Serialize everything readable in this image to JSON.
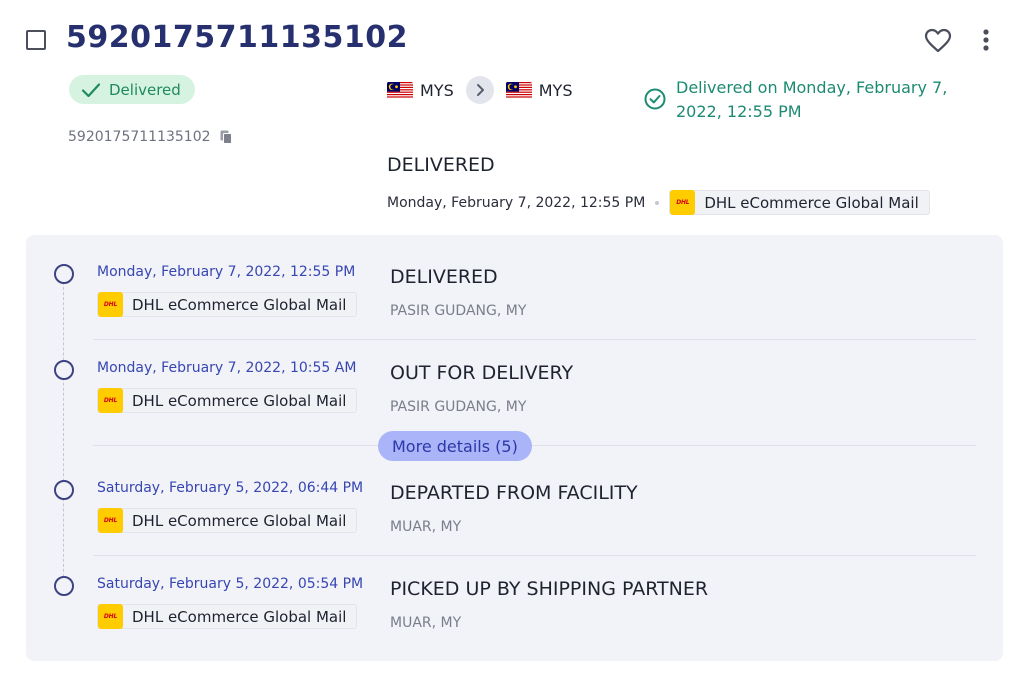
{
  "shipment": {
    "tracking_number": "5920175711135102",
    "sub_number": "5920175711135102",
    "status_badge": "Delivered",
    "origin_country": "MYS",
    "destination_country": "MYS",
    "delivered_on": "Delivered on Monday, February 7, 2022, 12:55 PM",
    "latest_status": "DELIVERED",
    "latest_datetime": "Monday, February 7, 2022, 12:55 PM",
    "latest_carrier": "DHL eCommerce Global Mail"
  },
  "icons": {
    "favorite": "heart-icon",
    "menu": "kebab-icon",
    "copy": "copy-icon",
    "badge_check": "check-icon",
    "delivered_check": "check-circle-icon",
    "route_arrow": "chevron-right-icon",
    "flag": "malaysia-flag-icon",
    "carrier_logo_text": "DHL"
  },
  "colors": {
    "title": "#27306f",
    "badge_bg": "#d6f3e2",
    "badge_text": "#1f8a5a",
    "delivered_text": "#1d8a72",
    "event_date": "#3846b2",
    "more_details_bg": "#a9b4f9",
    "carrier_yellow": "#ffcc00",
    "carrier_red": "#d40511"
  },
  "timeline": {
    "events": [
      {
        "datetime": "Monday, February 7, 2022, 12:55 PM",
        "carrier": "DHL eCommerce Global Mail",
        "status": "DELIVERED",
        "location": "PASIR GUDANG, MY"
      },
      {
        "datetime": "Monday, February 7, 2022, 10:55 AM",
        "carrier": "DHL eCommerce Global Mail",
        "status": "OUT FOR DELIVERY",
        "location": "PASIR GUDANG, MY"
      },
      {
        "datetime": "Saturday, February 5, 2022, 06:44 PM",
        "carrier": "DHL eCommerce Global Mail",
        "status": "DEPARTED FROM FACILITY",
        "location": "MUAR, MY"
      },
      {
        "datetime": "Saturday, February 5, 2022, 05:54 PM",
        "carrier": "DHL eCommerce Global Mail",
        "status": "PICKED UP BY SHIPPING PARTNER",
        "location": "MUAR, MY"
      }
    ],
    "more_details_label": "More details (5)"
  }
}
